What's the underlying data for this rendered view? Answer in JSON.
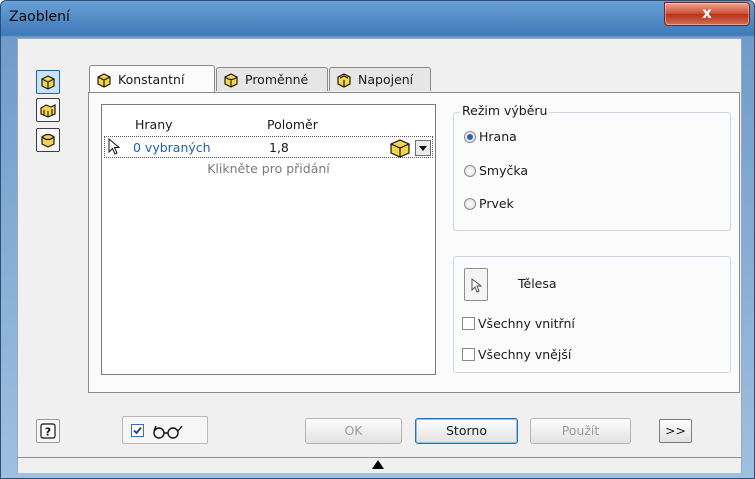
{
  "window": {
    "title": "Zaoblení",
    "close_symbol": "x"
  },
  "tabs": [
    {
      "label": "Konstantní",
      "icon": "cube-constant-icon",
      "active": true
    },
    {
      "label": "Proměnné",
      "icon": "cube-variable-icon",
      "active": false
    },
    {
      "label": "Napojení",
      "icon": "cube-setback-icon",
      "active": false
    }
  ],
  "side_buttons": [
    {
      "icon": "edge-fillet-icon",
      "active": true
    },
    {
      "icon": "face-fillet-icon",
      "active": false
    },
    {
      "icon": "full-round-fillet-icon",
      "active": false
    }
  ],
  "grid": {
    "col_edges": "Hrany",
    "col_radius": "Poloměr",
    "row": {
      "edges": "0 vybraných",
      "radius": "1,8"
    },
    "hint": "Klikněte pro přidání"
  },
  "selection_mode": {
    "title": "Režim výběru",
    "options": [
      {
        "label": "Hrana",
        "selected": true
      },
      {
        "label": "Smyčka",
        "selected": false
      },
      {
        "label": "Prvek",
        "selected": false
      }
    ]
  },
  "bodies": {
    "label": "Tělesa",
    "checks": [
      {
        "label": "Všechny vnitřní",
        "checked": false
      },
      {
        "label": "Všechny vnější",
        "checked": false
      }
    ]
  },
  "buttons": {
    "ok": "OK",
    "cancel": "Storno",
    "apply": "Použít",
    "more": ">>",
    "help": "?"
  },
  "preview": {
    "checked": true
  },
  "colors": {
    "link": "#1f5cbf",
    "accent": "#2a62b4",
    "title_bar": "#3f79b8",
    "close": "#c8442b"
  }
}
